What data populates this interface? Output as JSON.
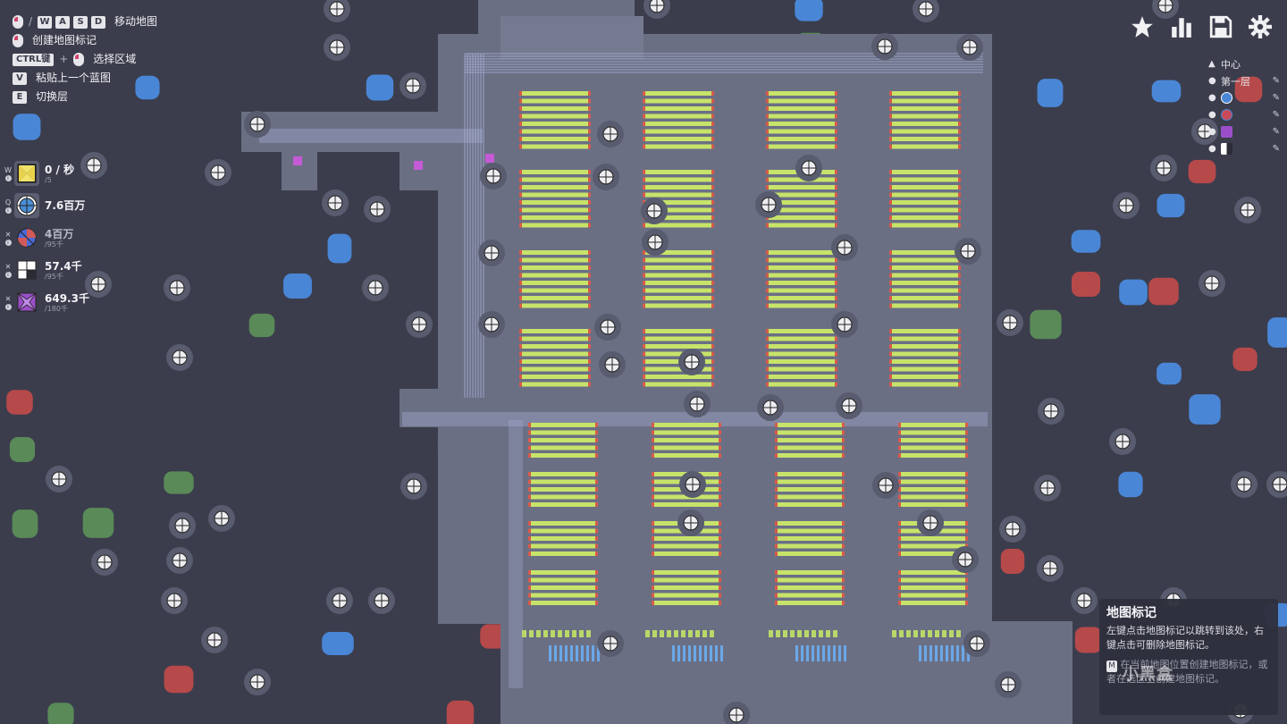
{
  "help": {
    "items": [
      {
        "keys": [
          "W",
          "A",
          "S",
          "D"
        ],
        "prefix_mouse": true,
        "label": "移动地图"
      },
      {
        "keys": [],
        "prefix_mouse": true,
        "label": "创建地图标记"
      },
      {
        "keys": [
          "CTRL键"
        ],
        "mouse_after": true,
        "label": "选择区域"
      },
      {
        "keys": [
          "V"
        ],
        "label": "粘贴上一个蓝图"
      },
      {
        "keys": [
          "E"
        ],
        "label": "切换层"
      }
    ],
    "sep": "/",
    "plus": "+"
  },
  "resources": [
    {
      "side": "W",
      "value": "0 / 秒",
      "goal": "/5",
      "icon": "goal-shape-icon",
      "color": "#e8d24a",
      "active": true
    },
    {
      "side": "Q",
      "value": "7.6百万",
      "goal": "",
      "icon": "circle-target-icon",
      "color": "#4a8ed6",
      "active": true
    },
    {
      "side": "✕",
      "value": "4百万",
      "goal": "/95千",
      "icon": "spiral-shape-icon",
      "color": "#d05a5a",
      "active": false,
      "dim": true
    },
    {
      "side": "✕",
      "value": "57.4千",
      "goal": "/95千",
      "icon": "quadrant-shape-icon",
      "color": "#ffffff",
      "active": false
    },
    {
      "side": "✕",
      "value": "649.3千",
      "goal": "/180千",
      "icon": "purple-star-shape-icon",
      "color": "#9a4fc8",
      "active": false
    }
  ],
  "toolbar": [
    "star-icon",
    "stats-icon",
    "save-icon",
    "settings-icon"
  ],
  "markers": {
    "center": "中心",
    "layer1": "第一层",
    "icons": [
      "blue-circle",
      "red-spiral",
      "purple-star",
      "quadrant"
    ]
  },
  "tooltip": {
    "title": "地图标记",
    "body": "左键点击地图标记以跳转到该处，右键点击可删除地图标记。",
    "hint_key": "M",
    "hint": "在当前地图位置创建地图标记，或者在选区上创建地图标记。"
  },
  "watermark": "小黑盒",
  "colors": {
    "background": "#3b3d4c",
    "factory_floor": "#6b6f84",
    "machine_green": "#c7e36a",
    "machine_red": "#d95a4a",
    "patch_blue": "#4a86d6",
    "patch_red": "#b6494a",
    "patch_green": "#5a8a58"
  }
}
